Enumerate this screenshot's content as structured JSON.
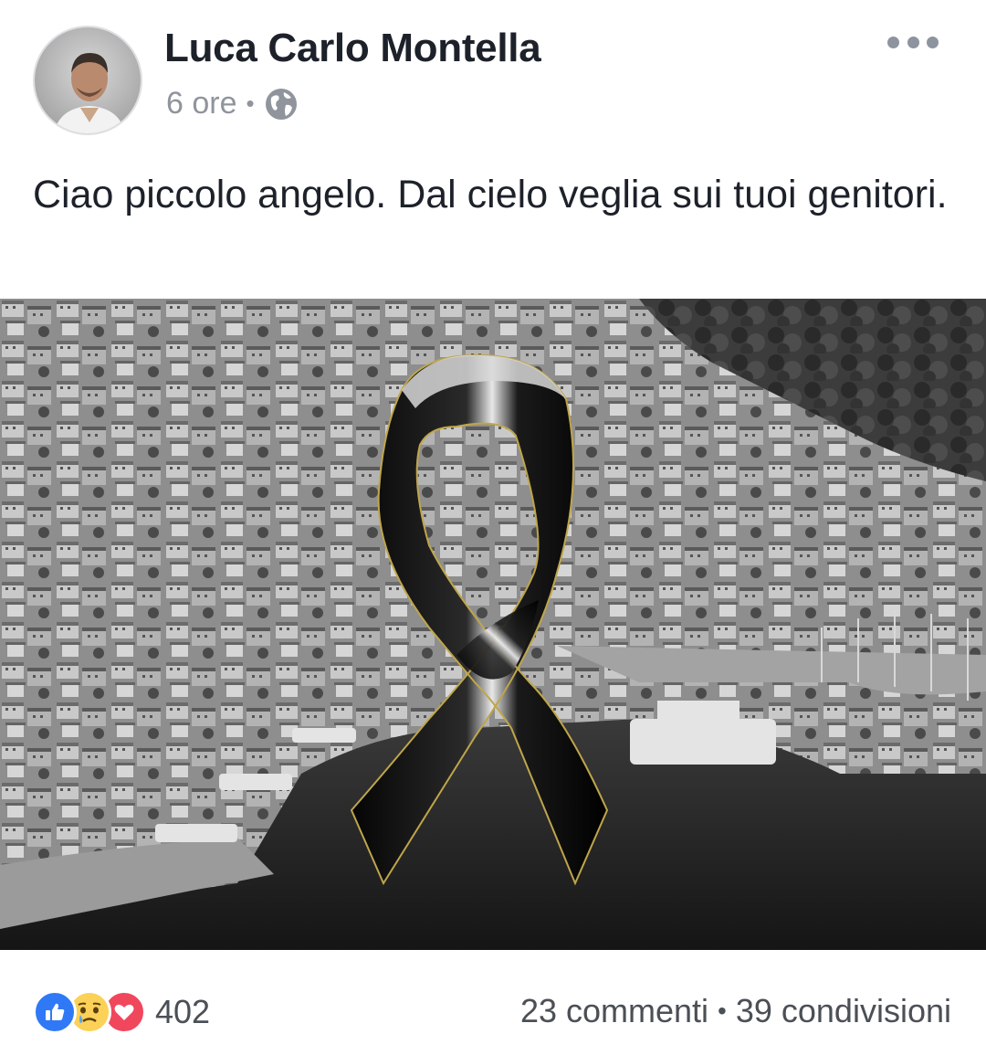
{
  "post": {
    "author": "Luca Carlo Montella",
    "time": "6 ore",
    "separator": "•",
    "privacy_icon": "globe-icon",
    "more_icon": "more-options-icon",
    "text": "Ciao piccolo angelo. Dal cielo veglia sui tuoi genitori."
  },
  "photo": {
    "subject": "black-mourning-ribbon-over-harbor-town",
    "icon": "mourning-ribbon-icon"
  },
  "reactions": {
    "icons": [
      "like-icon",
      "sad-icon",
      "love-icon"
    ],
    "count": "402"
  },
  "stats": {
    "comments": "23 commenti",
    "separator": "•",
    "shares": "39 condivisioni"
  },
  "colors": {
    "like": "#2f79f6",
    "sad": "#fbd157",
    "love": "#f0475c",
    "meta_text": "#90949c",
    "body_text": "#1d2129"
  }
}
